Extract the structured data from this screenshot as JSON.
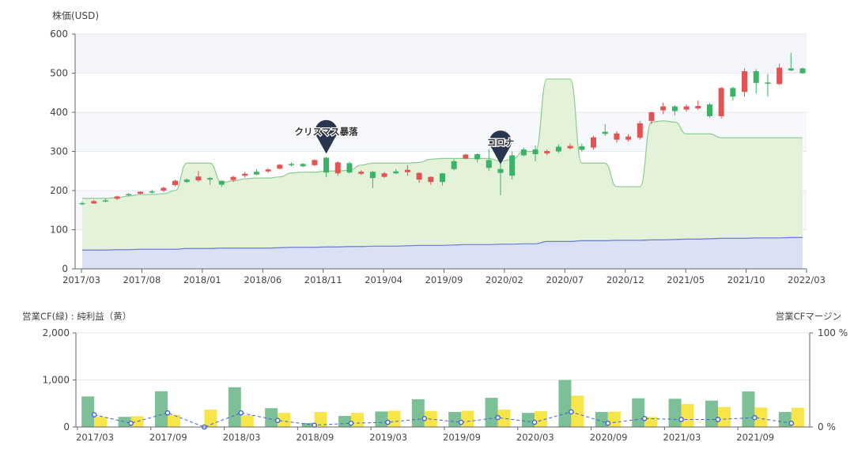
{
  "chart_data": [
    {
      "type": "candlestick",
      "ylabel": "株価(USD)",
      "ylim": [
        0,
        600
      ],
      "yticks": [
        0,
        100,
        200,
        300,
        400,
        500,
        600
      ],
      "xtick_labels": [
        "2017/03",
        "2017/08",
        "2018/01",
        "2018/06",
        "2018/11",
        "2019/04",
        "2019/09",
        "2020/02",
        "2020/07",
        "2020/12",
        "2021/05",
        "2021/10",
        "2022/03"
      ],
      "candles": [
        {
          "o": 165,
          "c": 168,
          "h": 172,
          "l": 163
        },
        {
          "o": 173,
          "c": 167,
          "h": 176,
          "l": 166
        },
        {
          "o": 172,
          "c": 175,
          "h": 180,
          "l": 170
        },
        {
          "o": 185,
          "c": 179,
          "h": 187,
          "l": 176
        },
        {
          "o": 188,
          "c": 191,
          "h": 193,
          "l": 186
        },
        {
          "o": 197,
          "c": 192,
          "h": 198,
          "l": 190
        },
        {
          "o": 195,
          "c": 198,
          "h": 202,
          "l": 192
        },
        {
          "o": 207,
          "c": 200,
          "h": 210,
          "l": 196
        },
        {
          "o": 225,
          "c": 214,
          "h": 228,
          "l": 210
        },
        {
          "o": 222,
          "c": 228,
          "h": 231,
          "l": 220
        },
        {
          "o": 236,
          "c": 226,
          "h": 250,
          "l": 222
        },
        {
          "o": 228,
          "c": 232,
          "h": 235,
          "l": 215
        },
        {
          "o": 215,
          "c": 225,
          "h": 226,
          "l": 210
        },
        {
          "o": 235,
          "c": 227,
          "h": 238,
          "l": 222
        },
        {
          "o": 243,
          "c": 238,
          "h": 248,
          "l": 233
        },
        {
          "o": 241,
          "c": 248,
          "h": 255,
          "l": 239
        },
        {
          "o": 254,
          "c": 249,
          "h": 257,
          "l": 245
        },
        {
          "o": 266,
          "c": 256,
          "h": 268,
          "l": 254
        },
        {
          "o": 265,
          "c": 268,
          "h": 272,
          "l": 262
        },
        {
          "o": 262,
          "c": 268,
          "h": 270,
          "l": 260
        },
        {
          "o": 278,
          "c": 265,
          "h": 280,
          "l": 262
        },
        {
          "o": 246,
          "c": 284,
          "h": 286,
          "l": 234
        },
        {
          "o": 272,
          "c": 244,
          "h": 275,
          "l": 238
        },
        {
          "o": 246,
          "c": 270,
          "h": 273,
          "l": 244
        },
        {
          "o": 248,
          "c": 243,
          "h": 252,
          "l": 240
        },
        {
          "o": 232,
          "c": 248,
          "h": 250,
          "l": 206
        },
        {
          "o": 244,
          "c": 235,
          "h": 248,
          "l": 232
        },
        {
          "o": 244,
          "c": 249,
          "h": 255,
          "l": 242
        },
        {
          "o": 253,
          "c": 247,
          "h": 265,
          "l": 238
        },
        {
          "o": 245,
          "c": 228,
          "h": 247,
          "l": 220
        },
        {
          "o": 235,
          "c": 222,
          "h": 236,
          "l": 215
        },
        {
          "o": 222,
          "c": 244,
          "h": 245,
          "l": 213
        },
        {
          "o": 255,
          "c": 275,
          "h": 280,
          "l": 252
        },
        {
          "o": 292,
          "c": 282,
          "h": 294,
          "l": 280
        },
        {
          "o": 280,
          "c": 293,
          "h": 295,
          "l": 272
        },
        {
          "o": 258,
          "c": 278,
          "h": 306,
          "l": 250
        },
        {
          "o": 245,
          "c": 255,
          "h": 272,
          "l": 188
        },
        {
          "o": 238,
          "c": 290,
          "h": 300,
          "l": 228
        },
        {
          "o": 290,
          "c": 305,
          "h": 310,
          "l": 288
        },
        {
          "o": 293,
          "c": 305,
          "h": 315,
          "l": 275
        },
        {
          "o": 301,
          "c": 295,
          "h": 305,
          "l": 290
        },
        {
          "o": 300,
          "c": 312,
          "h": 318,
          "l": 296
        },
        {
          "o": 314,
          "c": 308,
          "h": 320,
          "l": 305
        },
        {
          "o": 304,
          "c": 313,
          "h": 320,
          "l": 300
        },
        {
          "o": 336,
          "c": 310,
          "h": 340,
          "l": 305
        },
        {
          "o": 345,
          "c": 350,
          "h": 370,
          "l": 340
        },
        {
          "o": 346,
          "c": 330,
          "h": 352,
          "l": 322
        },
        {
          "o": 338,
          "c": 330,
          "h": 344,
          "l": 325
        },
        {
          "o": 372,
          "c": 335,
          "h": 378,
          "l": 330
        },
        {
          "o": 400,
          "c": 378,
          "h": 402,
          "l": 370
        },
        {
          "o": 415,
          "c": 405,
          "h": 425,
          "l": 395
        },
        {
          "o": 403,
          "c": 415,
          "h": 418,
          "l": 392
        },
        {
          "o": 415,
          "c": 407,
          "h": 420,
          "l": 402
        },
        {
          "o": 416,
          "c": 410,
          "h": 430,
          "l": 406
        },
        {
          "o": 390,
          "c": 420,
          "h": 424,
          "l": 386
        },
        {
          "o": 462,
          "c": 390,
          "h": 465,
          "l": 384
        },
        {
          "o": 440,
          "c": 462,
          "h": 465,
          "l": 430
        },
        {
          "o": 505,
          "c": 452,
          "h": 512,
          "l": 440
        },
        {
          "o": 475,
          "c": 505,
          "h": 510,
          "l": 448
        },
        {
          "o": 476,
          "c": 476,
          "h": 498,
          "l": 440
        },
        {
          "o": 514,
          "c": 472,
          "h": 524,
          "l": 470
        },
        {
          "o": 507,
          "c": 512,
          "h": 552,
          "l": 505
        },
        {
          "o": 500,
          "c": 512,
          "h": 514,
          "l": 498
        }
      ],
      "bands": {
        "upper": [
          180,
          180,
          180,
          182,
          186,
          190,
          190,
          192,
          200,
          270,
          270,
          270,
          220,
          225,
          230,
          232,
          232,
          235,
          245,
          247,
          247,
          250,
          250,
          252,
          265,
          270,
          270,
          270,
          270,
          272,
          280,
          282,
          282,
          282,
          282,
          282,
          275,
          280,
          300,
          300,
          485,
          485,
          485,
          270,
          270,
          270,
          210,
          210,
          210,
          375,
          378,
          375,
          345,
          345,
          345,
          335,
          335,
          335,
          335,
          335,
          335,
          335,
          335
        ],
        "lower": [
          48,
          48,
          48,
          49,
          49,
          50,
          50,
          50,
          50,
          52,
          52,
          52,
          53,
          53,
          53,
          53,
          53,
          54,
          55,
          55,
          55,
          56,
          56,
          57,
          57,
          58,
          58,
          58,
          59,
          60,
          60,
          60,
          61,
          62,
          62,
          62,
          63,
          63,
          64,
          64,
          70,
          70,
          70,
          72,
          72,
          72,
          73,
          73,
          73,
          74,
          74,
          75,
          76,
          76,
          77,
          78,
          78,
          78,
          79,
          79,
          79,
          80,
          80
        ]
      },
      "annotations": [
        {
          "label": "クリスマス暴落",
          "index": 21,
          "value": 282
        },
        {
          "label": "コロナ",
          "index": 36,
          "value": 255
        }
      ],
      "colors": {
        "up": "#3bb265",
        "down": "#e25353",
        "upper_fill": "#e3f2d9",
        "upper_line": "#8ccb92",
        "lower_fill": "#dbe1f4",
        "lower_line": "#6a7ad8",
        "pin": "#28374f"
      }
    },
    {
      "type": "bar",
      "left_label": "営業CF(緑) : 純利益（黄）",
      "right_label": "営業CFマージン",
      "ylim": [
        0,
        2000
      ],
      "yticks": [
        "0",
        "1,000",
        "2,000"
      ],
      "y2lim": [
        0,
        100
      ],
      "y2ticks": [
        "0 %",
        "100 %"
      ],
      "xtick_labels": [
        "2017/03",
        "2017/09",
        "2018/03",
        "2018/09",
        "2019/03",
        "2019/09",
        "2020/03",
        "2020/09",
        "2021/03",
        "2021/09"
      ],
      "series": [
        {
          "name": "営業CF",
          "color": "#7dbf96",
          "values": [
            650,
            215,
            760,
            0,
            845,
            400,
            85,
            235,
            330,
            590,
            320,
            620,
            300,
            1000,
            320,
            610,
            600,
            560,
            755,
            320
          ]
        },
        {
          "name": "純利益",
          "color": "#f7e54a",
          "values": [
            215,
            230,
            255,
            370,
            250,
            300,
            320,
            300,
            345,
            340,
            345,
            370,
            335,
            665,
            325,
            215,
            490,
            425,
            415,
            410
          ]
        },
        {
          "name": "営業CFマージン",
          "color": "#3d64d8",
          "values": [
            13,
            4,
            15,
            0,
            15,
            7,
            2,
            4,
            5,
            9,
            5,
            10,
            5,
            16,
            4,
            9,
            8,
            8,
            10,
            4
          ]
        }
      ]
    }
  ]
}
